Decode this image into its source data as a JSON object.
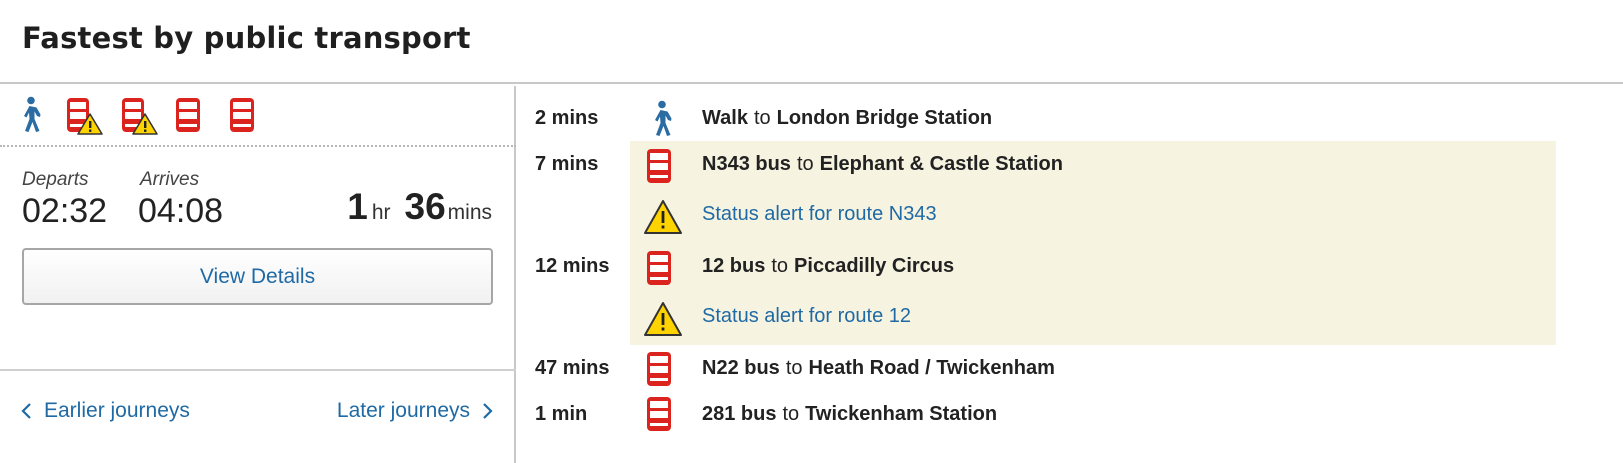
{
  "header": {
    "title": "Fastest by public transport"
  },
  "summary": {
    "mode_icons": [
      "walk-icon",
      "bus-alert-icon",
      "bus-alert-icon",
      "bus-icon",
      "bus-icon"
    ],
    "departs_label": "Departs",
    "arrives_label": "Arrives",
    "departs_time": "02:32",
    "arrives_time": "04:08",
    "duration_hours": "1",
    "duration_hours_unit": "hr",
    "duration_minutes": "36",
    "duration_minutes_unit": "mins",
    "view_details_label": "View Details"
  },
  "navigation": {
    "earlier_label": "Earlier journeys",
    "later_label": "Later journeys"
  },
  "legs": [
    {
      "duration": "2 mins",
      "icon": "walk-icon",
      "service": "Walk",
      "connector": "to",
      "destination": "London Bridge Station"
    },
    {
      "duration": "7 mins",
      "icon": "bus-icon",
      "service": "N343 bus",
      "connector": "to",
      "destination": "Elephant & Castle Station",
      "alert": "Status alert for route N343"
    },
    {
      "duration": "12 mins",
      "icon": "bus-icon",
      "service": "12 bus",
      "connector": "to",
      "destination": "Piccadilly Circus",
      "alert": "Status alert for route 12"
    },
    {
      "duration": "47 mins",
      "icon": "bus-icon",
      "service": "N22 bus",
      "connector": "to",
      "destination": "Heath Road / Twickenham"
    },
    {
      "duration": "1 min",
      "icon": "bus-icon",
      "service": "281 bus",
      "connector": "to",
      "destination": "Twickenham Station"
    }
  ],
  "colors": {
    "link": "#1f6aa5",
    "bus_red": "#dc241f",
    "walk_blue": "#2b6ca3",
    "alert_yellow": "#ffd300",
    "alert_highlight": "#f7f3e1",
    "divider": "#c8c8c8"
  }
}
